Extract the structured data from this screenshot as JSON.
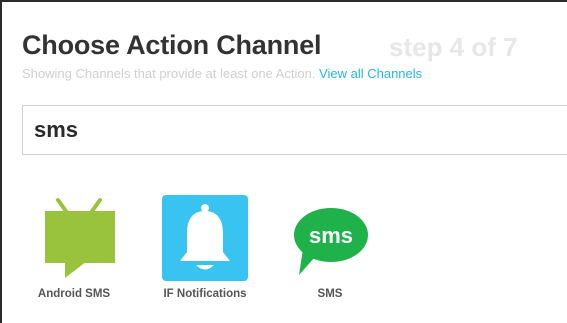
{
  "header": {
    "title": "Choose Action Channel",
    "step": "step 4 of 7",
    "subtitle": "Showing Channels that provide at least one Action.",
    "view_all_link": "View all Channels"
  },
  "search": {
    "value": "sms"
  },
  "channels": [
    {
      "label": "Android SMS",
      "icon": "android-sms-icon",
      "color": "#9ac33d"
    },
    {
      "label": "IF Notifications",
      "icon": "bell-icon",
      "color": "#39c3f0"
    },
    {
      "label": "SMS",
      "icon": "sms-bubble-icon",
      "color": "#1fb24a",
      "icon_text": "sms"
    }
  ]
}
